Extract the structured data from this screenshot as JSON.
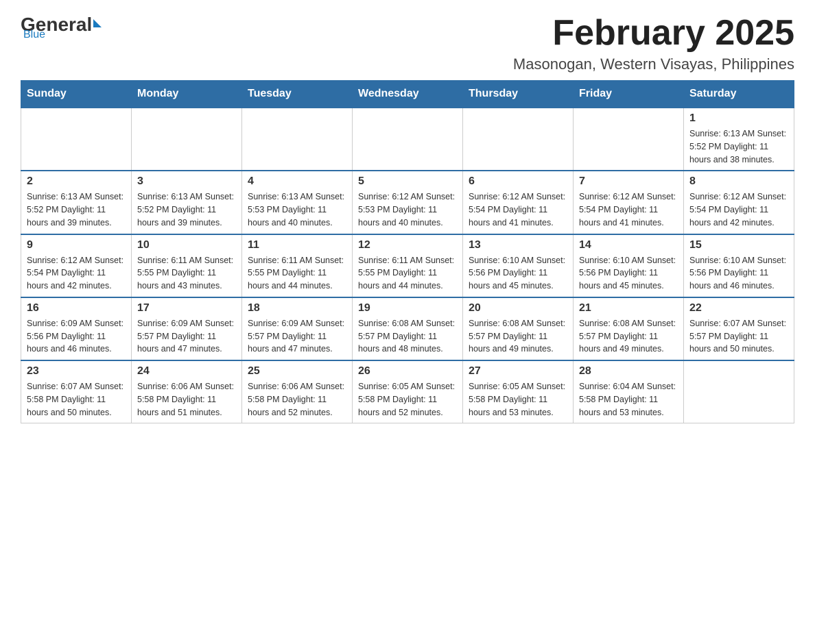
{
  "header": {
    "logo": {
      "general": "General",
      "blue": "Blue"
    },
    "title": "February 2025",
    "subtitle": "Masonogan, Western Visayas, Philippines"
  },
  "days_of_week": [
    "Sunday",
    "Monday",
    "Tuesday",
    "Wednesday",
    "Thursday",
    "Friday",
    "Saturday"
  ],
  "weeks": [
    [
      {
        "day": "",
        "info": ""
      },
      {
        "day": "",
        "info": ""
      },
      {
        "day": "",
        "info": ""
      },
      {
        "day": "",
        "info": ""
      },
      {
        "day": "",
        "info": ""
      },
      {
        "day": "",
        "info": ""
      },
      {
        "day": "1",
        "info": "Sunrise: 6:13 AM\nSunset: 5:52 PM\nDaylight: 11 hours and 38 minutes."
      }
    ],
    [
      {
        "day": "2",
        "info": "Sunrise: 6:13 AM\nSunset: 5:52 PM\nDaylight: 11 hours and 39 minutes."
      },
      {
        "day": "3",
        "info": "Sunrise: 6:13 AM\nSunset: 5:52 PM\nDaylight: 11 hours and 39 minutes."
      },
      {
        "day": "4",
        "info": "Sunrise: 6:13 AM\nSunset: 5:53 PM\nDaylight: 11 hours and 40 minutes."
      },
      {
        "day": "5",
        "info": "Sunrise: 6:12 AM\nSunset: 5:53 PM\nDaylight: 11 hours and 40 minutes."
      },
      {
        "day": "6",
        "info": "Sunrise: 6:12 AM\nSunset: 5:54 PM\nDaylight: 11 hours and 41 minutes."
      },
      {
        "day": "7",
        "info": "Sunrise: 6:12 AM\nSunset: 5:54 PM\nDaylight: 11 hours and 41 minutes."
      },
      {
        "day": "8",
        "info": "Sunrise: 6:12 AM\nSunset: 5:54 PM\nDaylight: 11 hours and 42 minutes."
      }
    ],
    [
      {
        "day": "9",
        "info": "Sunrise: 6:12 AM\nSunset: 5:54 PM\nDaylight: 11 hours and 42 minutes."
      },
      {
        "day": "10",
        "info": "Sunrise: 6:11 AM\nSunset: 5:55 PM\nDaylight: 11 hours and 43 minutes."
      },
      {
        "day": "11",
        "info": "Sunrise: 6:11 AM\nSunset: 5:55 PM\nDaylight: 11 hours and 44 minutes."
      },
      {
        "day": "12",
        "info": "Sunrise: 6:11 AM\nSunset: 5:55 PM\nDaylight: 11 hours and 44 minutes."
      },
      {
        "day": "13",
        "info": "Sunrise: 6:10 AM\nSunset: 5:56 PM\nDaylight: 11 hours and 45 minutes."
      },
      {
        "day": "14",
        "info": "Sunrise: 6:10 AM\nSunset: 5:56 PM\nDaylight: 11 hours and 45 minutes."
      },
      {
        "day": "15",
        "info": "Sunrise: 6:10 AM\nSunset: 5:56 PM\nDaylight: 11 hours and 46 minutes."
      }
    ],
    [
      {
        "day": "16",
        "info": "Sunrise: 6:09 AM\nSunset: 5:56 PM\nDaylight: 11 hours and 46 minutes."
      },
      {
        "day": "17",
        "info": "Sunrise: 6:09 AM\nSunset: 5:57 PM\nDaylight: 11 hours and 47 minutes."
      },
      {
        "day": "18",
        "info": "Sunrise: 6:09 AM\nSunset: 5:57 PM\nDaylight: 11 hours and 47 minutes."
      },
      {
        "day": "19",
        "info": "Sunrise: 6:08 AM\nSunset: 5:57 PM\nDaylight: 11 hours and 48 minutes."
      },
      {
        "day": "20",
        "info": "Sunrise: 6:08 AM\nSunset: 5:57 PM\nDaylight: 11 hours and 49 minutes."
      },
      {
        "day": "21",
        "info": "Sunrise: 6:08 AM\nSunset: 5:57 PM\nDaylight: 11 hours and 49 minutes."
      },
      {
        "day": "22",
        "info": "Sunrise: 6:07 AM\nSunset: 5:57 PM\nDaylight: 11 hours and 50 minutes."
      }
    ],
    [
      {
        "day": "23",
        "info": "Sunrise: 6:07 AM\nSunset: 5:58 PM\nDaylight: 11 hours and 50 minutes."
      },
      {
        "day": "24",
        "info": "Sunrise: 6:06 AM\nSunset: 5:58 PM\nDaylight: 11 hours and 51 minutes."
      },
      {
        "day": "25",
        "info": "Sunrise: 6:06 AM\nSunset: 5:58 PM\nDaylight: 11 hours and 52 minutes."
      },
      {
        "day": "26",
        "info": "Sunrise: 6:05 AM\nSunset: 5:58 PM\nDaylight: 11 hours and 52 minutes."
      },
      {
        "day": "27",
        "info": "Sunrise: 6:05 AM\nSunset: 5:58 PM\nDaylight: 11 hours and 53 minutes."
      },
      {
        "day": "28",
        "info": "Sunrise: 6:04 AM\nSunset: 5:58 PM\nDaylight: 11 hours and 53 minutes."
      },
      {
        "day": "",
        "info": ""
      }
    ]
  ]
}
